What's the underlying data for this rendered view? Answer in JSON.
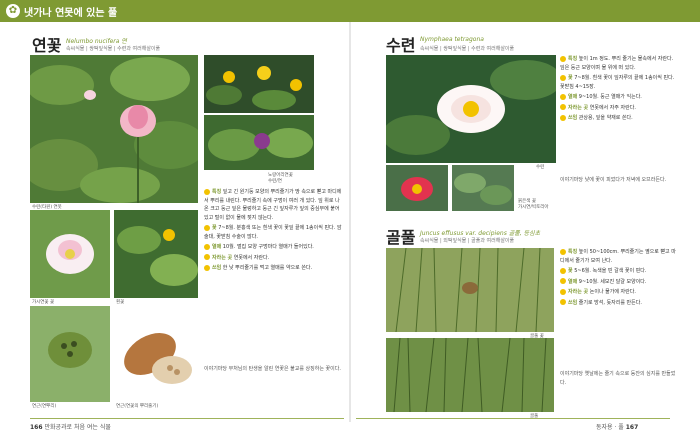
{
  "header": {
    "title": "냇가나 연못에 있는 풀",
    "icon": "leaf-icon"
  },
  "left": {
    "title": "연꽃",
    "sci": "Nelumbo nucifera 연",
    "cls": "속씨식물 | 쌍떡잎식물 | 수련과  여러해살이풀",
    "captions": [
      "수련(타원) 연못",
      "수련/연꽃",
      "노랑어리연꽃",
      "수련/연",
      "가시연꽃 꽃",
      "흰꽃",
      "가시연(가시연) 꽃",
      "연근(연뿌리)",
      "연근(연꽃의 뿌리줄기)"
    ],
    "text": [
      {
        "k": "특징",
        "v": "잎고 긴 원기둥 모양의 뿌리줄기가 땅 속으로 뻗고 마디에서 뿌리를 내린다. 뿌리줄기 속에 구멍이 여러 개 있다. 잎 위로 나온 크고 둥근 잎은 물렁하고 둥근 긴 잎자루가 잎의 중심부에 붙어 있고 털이 없이 물에 젖지 않는다."
      },
      {
        "k": "꽃",
        "v": "7~8월. 분홍색 또는 흰색 꽃이 꽃잎 끝에 1송이씩 핀다. 암술대, 꽃받침 수술이 많다."
      },
      {
        "k": "열매",
        "v": "10월. 벌집 모양 구멍마다 열매가 들어있다."
      },
      {
        "k": "자라는 곳",
        "v": "연못에서 자란다."
      },
      {
        "k": "쓰임",
        "v": "한 낮 뿌리줄기를 먹고 열매를 약으로 쓴다."
      }
    ],
    "note": "이야기마당  부처님의 탄생을 알린 연꽃은 불교를 상징하는 꽃이다.",
    "footer": {
      "page": "166",
      "text": "만화공과로 처음 여는 식물"
    }
  },
  "right": {
    "waterlily": {
      "title": "수련",
      "sci": "Nymphaea tetragona",
      "cls": "속씨식물 | 쌍떡잎식물 | 수련과  여러해살이풀",
      "captions": [
        "수련",
        "붉은색 꽃",
        "가시연/빅토리아"
      ],
      "text": [
        {
          "k": "특징",
          "v": "높이 1m 정도. 뿌리 줄기는 물속에서 자란다. 잎은 둥근 모양이며 물 위에 떠 있다."
        },
        {
          "k": "꽃",
          "v": "7~8월. 흰색 꽃이 잎자루의 끝에 1송이씩 핀다. 꽃받침 4~15장."
        },
        {
          "k": "열매",
          "v": "9~10월. 둥근 열매가 익는다."
        },
        {
          "k": "자라는 곳",
          "v": "연못에서 자주 자란다."
        },
        {
          "k": "쓰임",
          "v": "관상용, 잎을 약재로 쓴다."
        }
      ],
      "note": "이야기마당  낮에 꽃이 피었다가 저녁에 오므라든다."
    },
    "rush": {
      "title": "골풀",
      "sci": "Juncus effusus var. decipiens 골풀, 등심초",
      "cls": "속씨식물 | 외떡잎식물 | 골풀과  여러해살이풀",
      "captions": [
        "골풀 꽃",
        "골풀"
      ],
      "text": [
        {
          "k": "특징",
          "v": "높이 50~100cm. 뿌리줄기는 옆으로 뻗고 마디에서 줄기가 모여 난다."
        },
        {
          "k": "꽃",
          "v": "5~6월. 녹색을 띤 갈색 꽃이 핀다."
        },
        {
          "k": "열매",
          "v": "9~10월. 세모진 달걀 모양이다."
        },
        {
          "k": "자라는 곳",
          "v": "논이나 물가에 자란다."
        },
        {
          "k": "쓰임",
          "v": "줄기로 방석, 돗자리를 만든다."
        }
      ],
      "note": "이야기마당  옛날에는 줄기 속으로 등잔의 심지를 만들었다."
    },
    "footer": {
      "text": "동자용 · 풀",
      "page": "167"
    }
  },
  "colors": {
    "accent": "#7f9a33",
    "dot": "#f2c200",
    "lotus": "#e89ab4"
  }
}
